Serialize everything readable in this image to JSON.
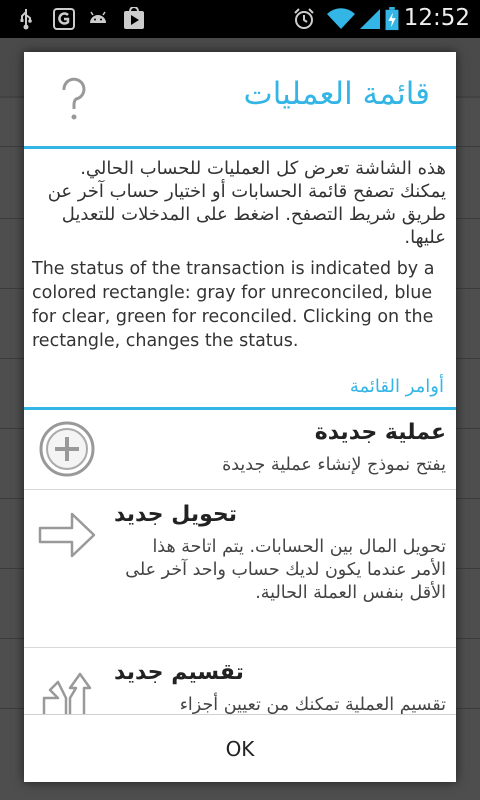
{
  "status_bar": {
    "time": "12:52",
    "icons": [
      "usb-icon",
      "g-icon",
      "android-icon",
      "play-store-icon",
      "alarm-icon",
      "wifi-icon",
      "signal-icon",
      "battery-charging-icon"
    ]
  },
  "dialog": {
    "title": "قائمة العمليات",
    "help_icon": "question-mark-icon",
    "intro_arabic": "هذه الشاشة تعرض كل العمليات للحساب الحالي. يمكنك تصفح قائمة الحسابات أو اختيار حساب آخر عن طريق شريط التصفح. اضغط على المدخلات للتعديل عليها.",
    "intro_english": "The status of the transaction is indicated by a colored rectangle: gray for unreconciled, blue for clear, green for reconciled. Clicking on the rectangle, changes the status.",
    "section_label": "أوامر القائمة",
    "commands": [
      {
        "icon": "plus-circle-icon",
        "title": "عملية جديدة",
        "description": "يفتح نموذج لإنشاء عملية جديدة"
      },
      {
        "icon": "arrow-right-icon",
        "title": "تحويل جديد",
        "description": "تحويل المال بين الحسابات. يتم اتاحة هذا الأمر عندما يكون لديك حساب واحد آخر على الأقل بنفس العملة الحالية."
      },
      {
        "icon": "split-arrow-icon",
        "title": "تقسيم جديد",
        "description": "تقسيم العملية تمكنك من تعيين أجزاء"
      }
    ],
    "ok_label": "OK"
  },
  "colors": {
    "accent": "#33b5e5",
    "text": "#333333",
    "status_bar": "#000000",
    "dialog_bg": "#ffffff"
  }
}
